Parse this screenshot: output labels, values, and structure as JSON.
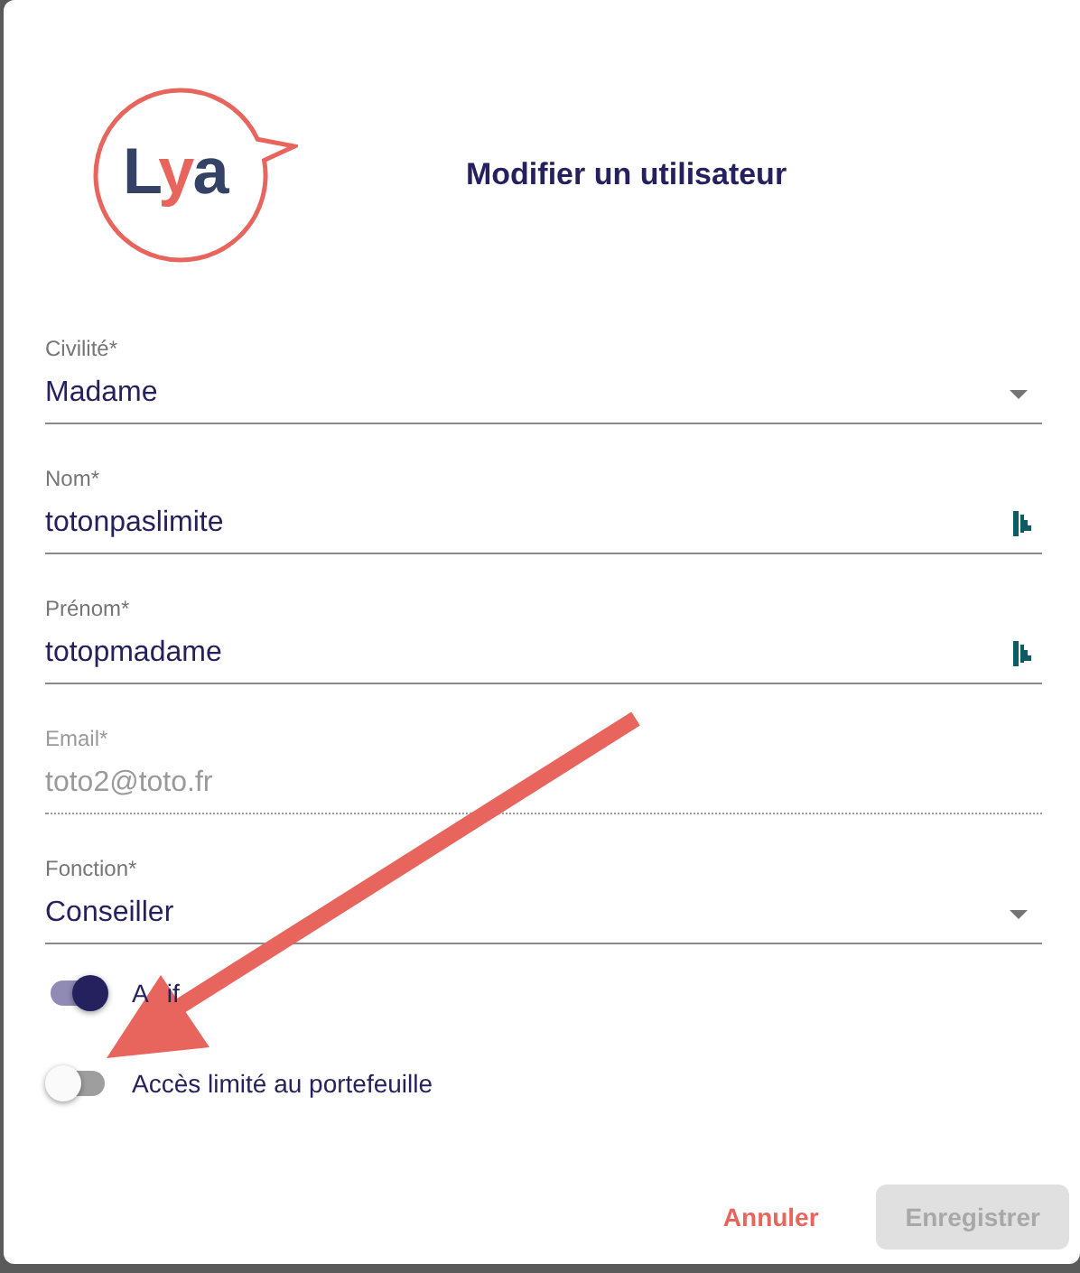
{
  "logo": {
    "text": "Lya"
  },
  "dialog": {
    "title": "Modifier un utilisateur"
  },
  "fields": [
    {
      "kind": "select",
      "label": "Civilité",
      "required_mark": "*",
      "value": "Madame",
      "disabled": false
    },
    {
      "kind": "text",
      "label": "Nom",
      "required_mark": "*",
      "value": "totonpaslimite",
      "disabled": false
    },
    {
      "kind": "text",
      "label": "Prénom",
      "required_mark": "*",
      "value": "totopmadame",
      "disabled": false
    },
    {
      "kind": "text",
      "label": "Email",
      "required_mark": "*",
      "value": "toto2@toto.fr",
      "disabled": true
    },
    {
      "kind": "select",
      "label": "Fonction",
      "required_mark": "*",
      "value": "Conseiller",
      "disabled": false
    }
  ],
  "toggles": [
    {
      "label_parts": [
        "A",
        "if"
      ],
      "on": true
    },
    {
      "label_parts": [
        "Accès limité au portefeuille"
      ],
      "on": false
    }
  ],
  "buttons": [
    {
      "kind": "text",
      "label": "Annuler",
      "disabled": false
    },
    {
      "kind": "filled",
      "label": "Enregistrer",
      "disabled": true
    }
  ]
}
